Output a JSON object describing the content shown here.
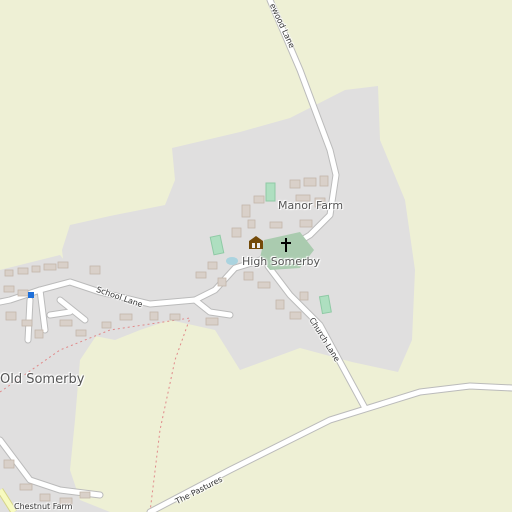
{
  "map": {
    "colors": {
      "farmland": "#eef0d5",
      "residential": "#e0dfdf",
      "road": "#ffffff",
      "road_casing": "#bbbbbb",
      "building": "#d9d0c9",
      "building_outline": "#c4b6ab",
      "green": "#aedfc0",
      "cemetery": "#aacbaf",
      "boundary": "#e08a8a",
      "marker": "#1e6fd9",
      "major_road": "#f7fabf"
    },
    "places": {
      "manor_farm": "Manor Farm",
      "high_somerby": "High Somerby",
      "old_somerby": "Old Somerby",
      "chestnut_farm": "Chestnut Farm"
    },
    "roads": {
      "top_lane": "ewood Lane",
      "school_lane": "School Lane",
      "church_lane": "Church Lane",
      "the_pastures": "The Pastures"
    },
    "icons": {
      "pub": "pub-icon",
      "church": "church-icon",
      "bus_stop": "bus-stop-icon"
    }
  }
}
